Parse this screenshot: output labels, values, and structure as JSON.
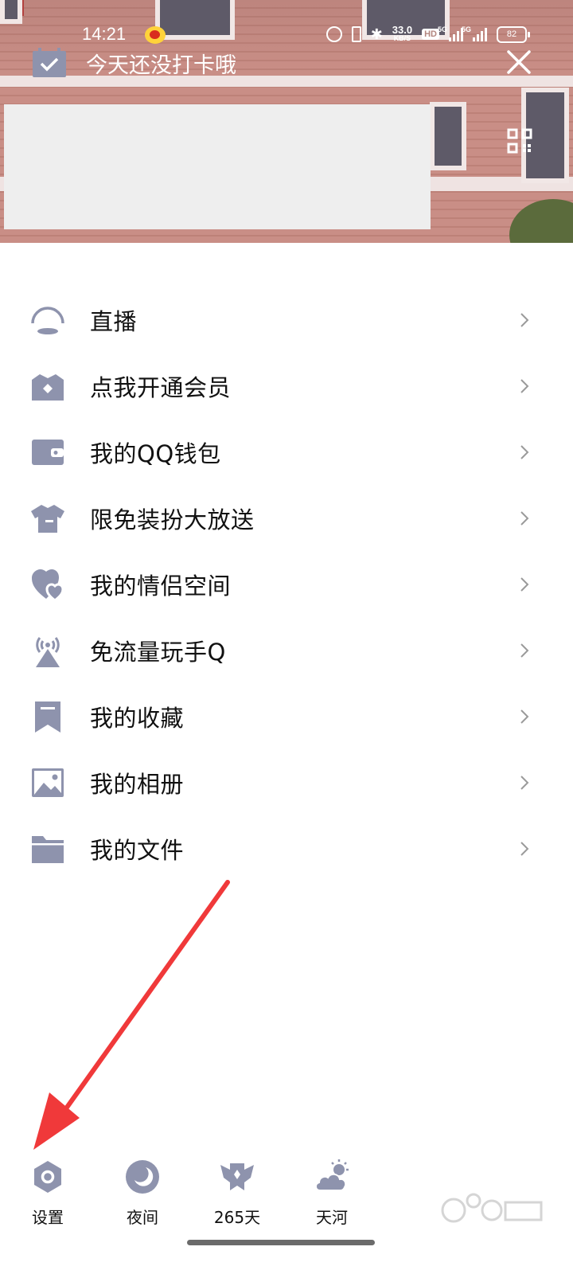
{
  "status_bar": {
    "time": "14:21",
    "net_speed_value": "33.0",
    "net_speed_unit": "KB/S",
    "hd_badge": "HD",
    "signal1_tag": "5G",
    "signal2_tag": "5G",
    "battery": "82"
  },
  "header": {
    "checkin_text": "今天还没打卡哦",
    "checkin_icon": "calendar-check-icon",
    "close_icon": "close-icon",
    "qr_icon": "qr-code-icon"
  },
  "menu": {
    "items": [
      {
        "label": "直播",
        "icon": "live-icon"
      },
      {
        "label": "点我开通会员",
        "icon": "vip-crown-icon"
      },
      {
        "label": "我的QQ钱包",
        "icon": "wallet-icon"
      },
      {
        "label": "限免装扮大放送",
        "icon": "tshirt-icon"
      },
      {
        "label": "我的情侣空间",
        "icon": "hearts-icon"
      },
      {
        "label": "免流量玩手Q",
        "icon": "signal-tower-icon"
      },
      {
        "label": "我的收藏",
        "icon": "bookmark-icon"
      },
      {
        "label": "我的相册",
        "icon": "photo-icon"
      },
      {
        "label": "我的文件",
        "icon": "folder-icon"
      }
    ]
  },
  "bottom_bar": {
    "items": [
      {
        "label": "设置",
        "icon": "settings-hex-icon"
      },
      {
        "label": "夜间",
        "icon": "moon-icon"
      },
      {
        "label": "265天",
        "icon": "winged-badge-icon"
      },
      {
        "label": "天河",
        "icon": "cloud-sun-icon"
      }
    ]
  },
  "colors": {
    "icon_gray": "#8e93ad",
    "arrow_red": "#f0393a",
    "text": "#111111"
  }
}
